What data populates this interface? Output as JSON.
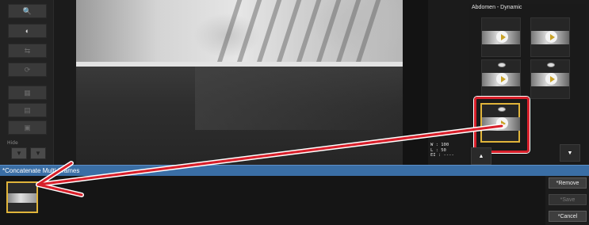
{
  "thumbnail_panel": {
    "title": "Abdomen - Dynamic"
  },
  "image_info": {
    "window": "W : 100",
    "level": "L : 50",
    "ei": "EI : ----"
  },
  "left_tools": {
    "hide_label": "Hide"
  },
  "concatenate_bar": {
    "title": "*Concatenate Multi-Frames"
  },
  "actions": {
    "remove_label": "*Remove",
    "save_label": "*Save",
    "cancel_label": "*Cancel"
  },
  "colors": {
    "accent_bar": "#3a6ea5",
    "selection": "#e0b43a",
    "callout": "#d81f2a"
  }
}
